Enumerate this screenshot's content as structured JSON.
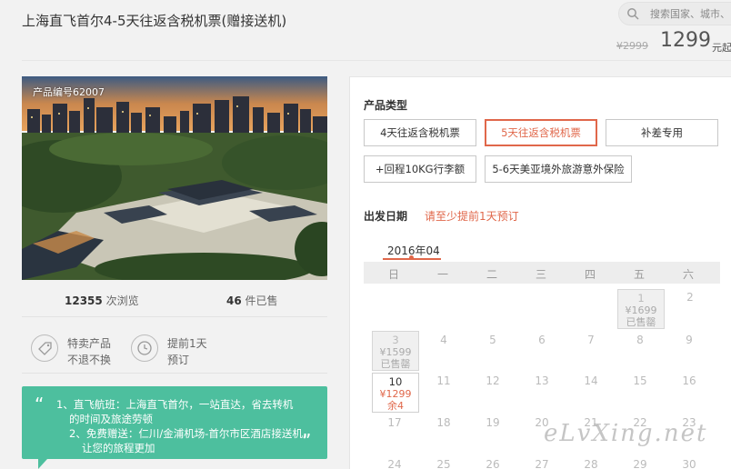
{
  "header": {
    "title": "上海直飞首尔4-5天往返含税机票(赠接送机)",
    "search_placeholder": "搜索国家、城市、",
    "price_old": "¥2999",
    "price_new": "1299",
    "price_unit": "元起"
  },
  "product": {
    "code_label": "产品编号62007",
    "views_count": "12355",
    "views_label": "次浏览",
    "sold_count": "46",
    "sold_label": "件已售",
    "features": [
      {
        "line1": "特卖产品",
        "line2": "不退不换",
        "icon": "tag-icon"
      },
      {
        "line1": "提前1天",
        "line2": "预订",
        "icon": "clock-icon"
      }
    ],
    "notes": [
      "1、直飞航班：上海直飞首尔，一站直达，省去转机",
      "的时间及旅途劳顿",
      "2、免费赠送：仁川/金浦机场-首尔市区酒店接送机，",
      "让您的旅程更加"
    ]
  },
  "booking": {
    "type_label": "产品类型",
    "options": [
      {
        "label": "4天往返含税机票",
        "selected": false
      },
      {
        "label": "5天往返含税机票",
        "selected": true
      },
      {
        "label": "补差专用",
        "selected": false
      },
      {
        "label": "+回程10KG行李额",
        "selected": false
      },
      {
        "label": "5-6天美亚境外旅游意外保险",
        "selected": false
      }
    ],
    "date_label": "出发日期",
    "date_hint": "请至少提前1天预订",
    "month": "2016年04",
    "weekdays": [
      "日",
      "一",
      "二",
      "三",
      "四",
      "五",
      "六"
    ],
    "cells": [
      {
        "day": "1",
        "price": "¥1699",
        "status": "已售罄",
        "active": false
      },
      {
        "day": "3",
        "price": "¥1599",
        "status": "已售罄",
        "active": false
      },
      {
        "day": "10",
        "price": "¥1299",
        "status": "余4",
        "active": true
      }
    ],
    "days": [
      "2",
      "4",
      "5",
      "6",
      "7",
      "8",
      "9",
      "11",
      "12",
      "13",
      "14",
      "15",
      "16",
      "17",
      "18",
      "19",
      "20",
      "21",
      "22",
      "23",
      "24",
      "25",
      "26",
      "27",
      "28",
      "29",
      "30"
    ]
  },
  "watermark": "eLvXing.net",
  "colors": {
    "accent": "#e0674a",
    "green": "#4dbf9e"
  }
}
